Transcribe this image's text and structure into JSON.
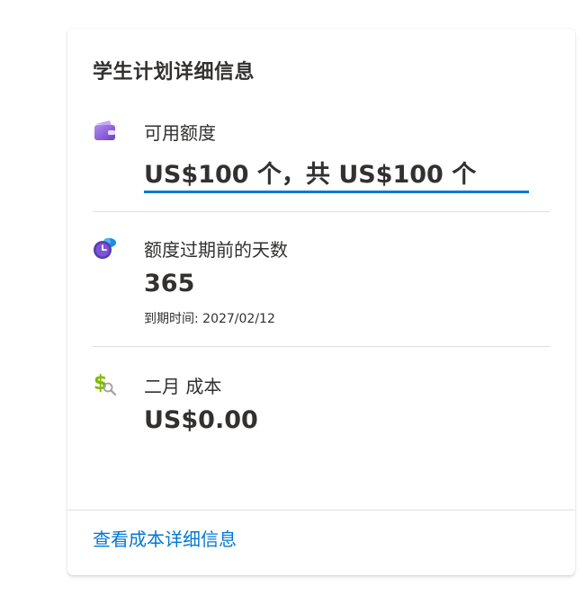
{
  "card": {
    "title": "学生计划详细信息",
    "credit": {
      "icon": "wallet-icon",
      "label": "可用额度",
      "value": "US$100 个，共 US$100 个"
    },
    "expiry": {
      "icon": "cloud-clock-icon",
      "label": "额度过期前的天数",
      "value": "365",
      "sub": "到期时间: 2027/02/12"
    },
    "cost": {
      "icon": "dollar-search-icon",
      "label": "二月 成本",
      "value": "US$0.00"
    },
    "footer_link": "查看成本详细信息"
  },
  "colors": {
    "accent": "#0078d4",
    "text": "#323130",
    "divider": "#e1dfdd",
    "wallet_purple": "#8661c5",
    "dollar_green": "#7fba00"
  }
}
